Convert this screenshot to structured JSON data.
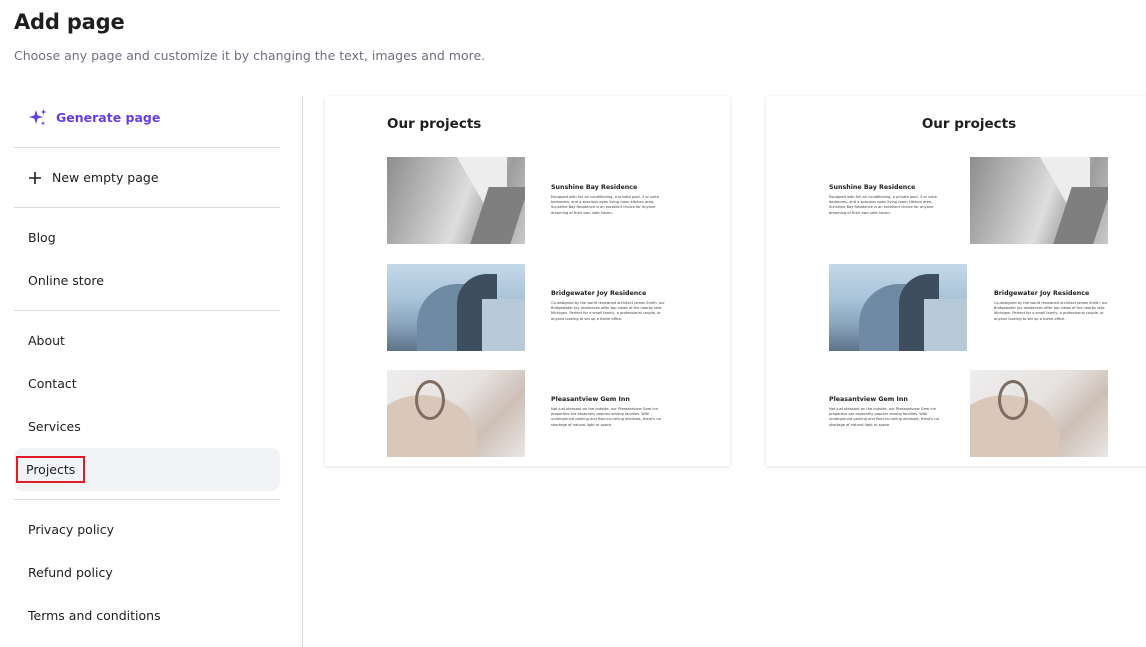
{
  "header": {
    "title": "Add page",
    "subtitle": "Choose any page and customize it by changing the text, images and more."
  },
  "sidebar": {
    "generate": {
      "label": "Generate page",
      "icon": "sparkles-icon",
      "color": "#673de6"
    },
    "new_empty": {
      "label": "New empty page",
      "icon": "plus-icon"
    },
    "group1": [
      {
        "label": "Blog"
      },
      {
        "label": "Online store"
      }
    ],
    "group2": [
      {
        "label": "About"
      },
      {
        "label": "Contact"
      },
      {
        "label": "Services"
      },
      {
        "label": "Projects",
        "selected": true
      }
    ],
    "group3": [
      {
        "label": "Privacy policy"
      },
      {
        "label": "Refund policy"
      },
      {
        "label": "Terms and conditions"
      }
    ]
  },
  "templates": [
    {
      "title": "Our projects",
      "layout": "image-left",
      "projects": [
        {
          "name": "Sunshine Bay Residence",
          "description": "Equipped with full air conditioning, a private pool, 3 or suite bedrooms, and a spacious open living room kitchen area, Sunshine Bay Residence is an excellent choice for anyone dreaming of their own safe haven.",
          "image": "concrete-architecture-photo"
        },
        {
          "name": "Bridgewater Joy Residence",
          "description": "Co-designed by the world renowned architect James Smith, our Bridgewater Joy residences offer top views of the nearby lake Michigan. Perfect for a small family, a professional couple, or anyone looking to set up a home office.",
          "image": "blue-metal-building-photo"
        },
        {
          "name": "Pleasantview Gem Inn",
          "description": "Not just pleasant on the outside, our Pleasantview Gem Inn properties are especially popular among families. With underground parking and floor-to-ceiling windows, there's no shortage of natural light or space.",
          "image": "beige-curved-building-photo"
        }
      ]
    },
    {
      "title": "Our projects",
      "layout": "alternating",
      "projects": [
        {
          "name": "Sunshine Bay Residence",
          "description": "Equipped with full air conditioning, a private pool, 3 or suite bedrooms, and a spacious open living room kitchen area, Sunshine Bay Residence is an excellent choice for anyone dreaming of their own safe haven.",
          "image": "concrete-architecture-photo"
        },
        {
          "name": "Bridgewater Joy Residence",
          "description": "Co-designed by the world renowned architect James Smith, our Bridgewater Joy residences offer top views of the nearby lake Michigan. Perfect for a small family, a professional couple, or anyone looking to set up a home office.",
          "image": "blue-metal-building-photo"
        },
        {
          "name": "Pleasantview Gem Inn",
          "description": "Not just pleasant on the outside, our Pleasantview Gem Inn properties are especially popular among families. With underground parking and floor-to-ceiling windows, there's no shortage of natural light or space.",
          "image": "beige-curved-building-photo"
        }
      ]
    }
  ]
}
